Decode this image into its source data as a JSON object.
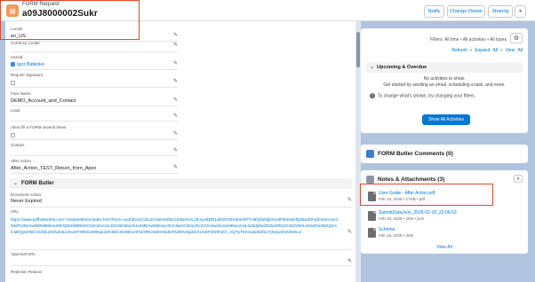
{
  "header": {
    "record_type": "FORM Request",
    "record_name": "a09J8000002Sukr",
    "buttons": [
      "Notify",
      "Change Owner",
      "Sharing"
    ],
    "menu_icon": "chevron-down-icon"
  },
  "details": {
    "locale": {
      "label": "Locale",
      "value": "en_US"
    },
    "currency_locale": {
      "label": "Currency Locale"
    },
    "userid": {
      "label": "UserId",
      "value": "Igor Bidenko"
    },
    "require_signature": {
      "label": "Require Signature"
    },
    "flow_name": {
      "label": "Flow Name",
      "value": "DEMO_Account_and_Contact"
    },
    "lead": {
      "label": "Lead"
    },
    "allow_fill": {
      "label": "Allow fill a FORM several times"
    },
    "contact": {
      "label": "Contact"
    },
    "after_action": {
      "label": "After Action",
      "value": "After_Action_TEST_Return_from_Apex"
    }
  },
  "form_butler": {
    "title": "FORM Butler",
    "document_action": {
      "label": "Document Action",
      "value": "Never Expired"
    },
    "url": {
      "label": "URL",
      "value": "https://www.pdfbutlertest.com:7443/webform/index.html?form=eyJhbGciOiJIUzI1NiIsInR5cCI6IkpXVCJ9.eyJ0ZW1wbGF0ZSI6ImRFTU9fQWNjb3VudF9hbmRfQ29udGFjdCIsImV4cCI6MTc4NzAwMDM5Mmx4NFQ0UhMDMiXCIsImZvcm1JZCI6ImEwOUo4MDAwMDAyU3VrclwiXCIsImJhc2VVcmwiOiJodHRwczovL3d3dy5wZGZidXRsZXJ0ZXN0LmNvbTo3NDQzIn0.kBQysinNiCn2Zf2uXGlUmbJJXuWYWNGaW9uIjoiZmlsbCIsInBhcmFtZXRlcnMiOnsidmFsdWVzIjpbXX19.EF4hr9h3Cl_AQTpTKKSq3eB4f11YjSrywnNS25HLU"
    },
    "approval_url": {
      "label": "Approval URL"
    },
    "rejection_reason": {
      "label": "Rejection Reason"
    }
  },
  "activity": {
    "filters_text": "Filters: All time • All activities • All types",
    "links": [
      "Refresh",
      "Expand All",
      "View All"
    ],
    "upcoming_title": "Upcoming & Overdue",
    "no_activities": "No activities to show.",
    "get_started": "Get started by sending an email, scheduling a task, and more.",
    "change_filters": "To change what's shown, try changing your filters.",
    "show_all_button": "Show All Activities"
  },
  "form_butler_comments": {
    "title": "FORM Butler Comments (0)"
  },
  "notes": {
    "title": "Notes & Attachments (3)",
    "items": [
      {
        "name": "User Guide - After Action.pdf",
        "meta": "Feb 18, 2026 • 17KB • pdf"
      },
      {
        "name": "SubmitDataJson_2026-02-18_23-06-52",
        "meta": "Feb 18, 2026 • 1KB • json"
      },
      {
        "name": "Schema",
        "meta": "Feb 18, 2026 • 2KB"
      }
    ],
    "view_all": "View All"
  },
  "colors": {
    "brand_blue": "#0176d3",
    "highlight_red": "#e8452c",
    "background": "#b0c4df",
    "record_icon": "#f49756",
    "comments_icon": "#3d7cc9",
    "notes_icon": "#8a96a8"
  }
}
